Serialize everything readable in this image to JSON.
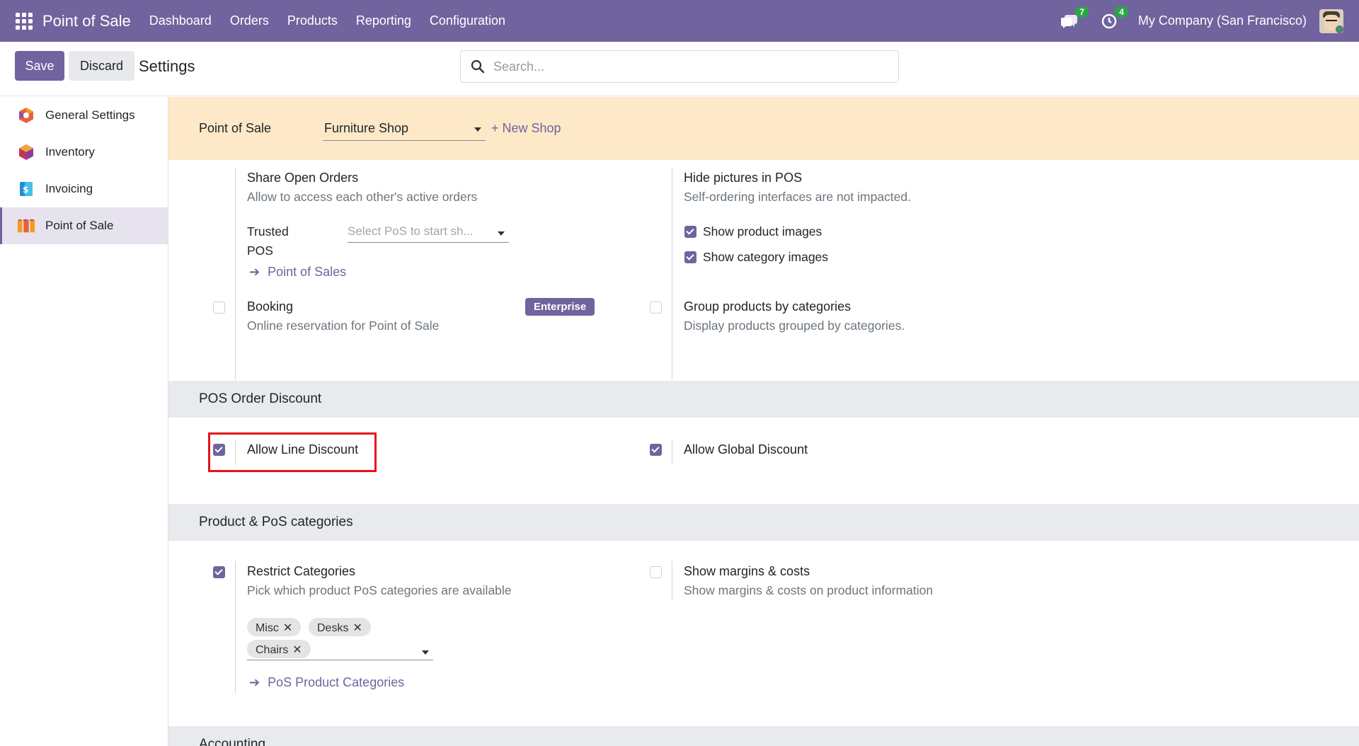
{
  "navbar": {
    "brand": "Point of Sale",
    "menu": [
      "Dashboard",
      "Orders",
      "Products",
      "Reporting",
      "Configuration"
    ],
    "messages_count": "7",
    "activities_count": "4",
    "company": "My Company (San Francisco)"
  },
  "control": {
    "save_label": "Save",
    "discard_label": "Discard",
    "title": "Settings",
    "search_placeholder": "Search..."
  },
  "sidebar": {
    "items": [
      {
        "label": "General Settings",
        "icon": "general-settings-icon"
      },
      {
        "label": "Inventory",
        "icon": "inventory-icon"
      },
      {
        "label": "Invoicing",
        "icon": "invoicing-icon"
      },
      {
        "label": "Point of Sale",
        "icon": "point-of-sale-icon",
        "active": true
      }
    ]
  },
  "shop_bar": {
    "label": "Point of Sale",
    "selected_shop": "Furniture Shop",
    "new_shop": "+ New Shop"
  },
  "settings": {
    "share_orders": {
      "title": "Share Open Orders",
      "desc": "Allow to access each other's active orders",
      "trusted_label_1": "Trusted",
      "trusted_label_2": "POS",
      "trusted_placeholder": "Select PoS to start sh...",
      "link": "Point of Sales"
    },
    "hide_pictures": {
      "title": "Hide pictures in POS",
      "desc": "Self-ordering interfaces are not impacted.",
      "option1": "Show product images",
      "option2": "Show category images"
    },
    "booking": {
      "title": "Booking",
      "desc": "Online reservation for Point of Sale",
      "badge": "Enterprise"
    },
    "group_products": {
      "title": "Group products by categories",
      "desc": "Display products grouped by categories."
    }
  },
  "sections": {
    "discount": "POS Order Discount",
    "categories": "Product & PoS categories",
    "accounting": "Accounting"
  },
  "discount": {
    "line": "Allow Line Discount",
    "global": "Allow Global Discount"
  },
  "categories": {
    "restrict_title": "Restrict Categories",
    "restrict_desc": "Pick which product PoS categories are available",
    "tags": [
      "Misc",
      "Desks",
      "Chairs"
    ],
    "link": "PoS Product Categories",
    "margins_title": "Show margins & costs",
    "margins_desc": "Show margins & costs on product information"
  },
  "colors": {
    "brand": "#71639e",
    "shop_bar": "#fde9c7",
    "highlight": "#e8111a"
  }
}
